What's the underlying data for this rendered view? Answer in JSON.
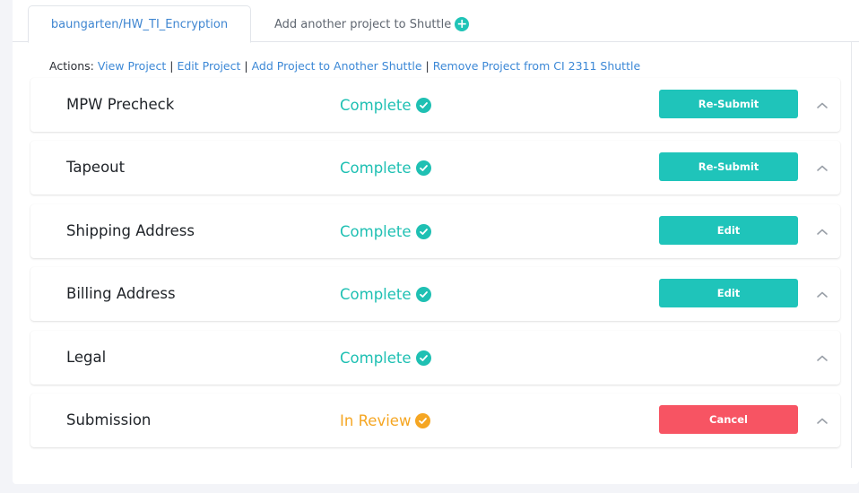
{
  "tabs": {
    "active_label": "baungarten/HW_TI_Encryption",
    "add_label": "Add another project to Shuttle"
  },
  "actions": {
    "prefix": "Actions:",
    "links": [
      "View Project",
      "Edit Project",
      "Add Project to Another Shuttle",
      "Remove Project from CI 2311 Shuttle"
    ],
    "separator": "|"
  },
  "steps": [
    {
      "name": "MPW Precheck",
      "status": "Complete",
      "button": "Re-Submit"
    },
    {
      "name": "Tapeout",
      "status": "Complete",
      "button": "Re-Submit"
    },
    {
      "name": "Shipping Address",
      "status": "Complete",
      "button": "Edit"
    },
    {
      "name": "Billing Address",
      "status": "Complete",
      "button": "Edit"
    },
    {
      "name": "Legal",
      "status": "Complete",
      "button": ""
    },
    {
      "name": "Submission",
      "status": "In Review",
      "button": "Cancel"
    }
  ],
  "colors": {
    "teal": "#1fc4ba",
    "status_complete": "#1fc0b3",
    "status_review": "#f5a623",
    "cancel": "#f75463",
    "link": "#3c88d6"
  },
  "icons": {
    "status": "check-circle-icon",
    "add": "plus-circle-icon",
    "collapse": "chevron-up-icon"
  }
}
